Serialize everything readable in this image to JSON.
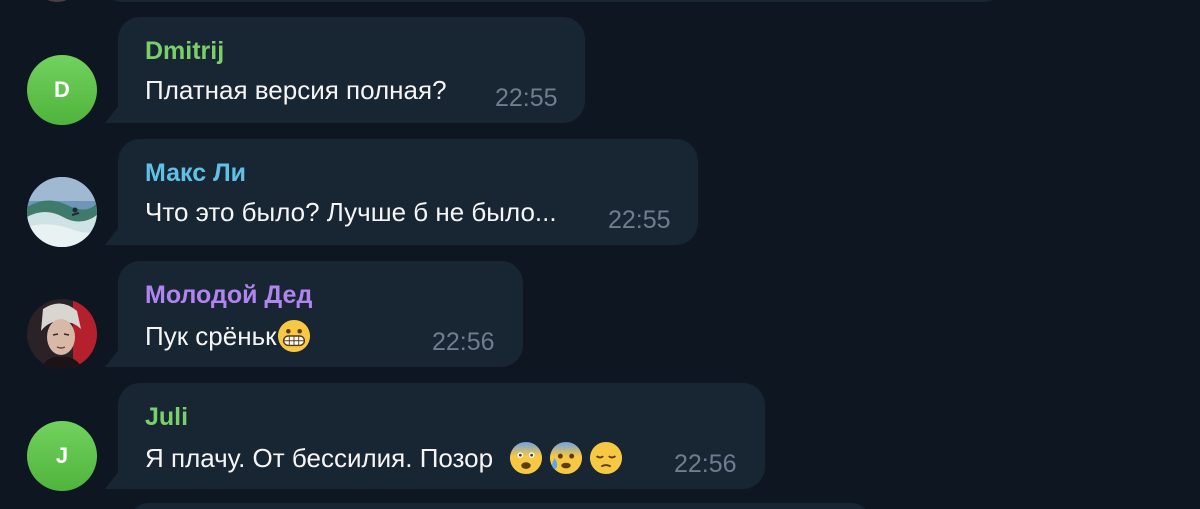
{
  "colors": {
    "background": "#0e1621",
    "bubble": "#182533",
    "time": "#6d7f8f",
    "text": "#f5f5f5"
  },
  "messages": [
    {
      "sender": "Dmitrij",
      "sender_color": "#7ccf68",
      "avatar_type": "letter",
      "avatar_letter": "D",
      "text": "Платная версия полная?",
      "time": "22:55"
    },
    {
      "sender": "Макс Ли",
      "sender_color": "#5fc1e6",
      "avatar_type": "photo-wave-surfer",
      "text": "Что это было? Лучше б не было...",
      "time": "22:55"
    },
    {
      "sender": "Молодой Дед",
      "sender_color": "#b185f0",
      "avatar_type": "photo-portrait",
      "text": "Пук срёньк",
      "emojis": [
        "grinning-face-emoji"
      ],
      "time": "22:56"
    },
    {
      "sender": "Juli",
      "sender_color": "#7ccf68",
      "avatar_type": "letter",
      "avatar_letter": "J",
      "text": "Я плачу. От бессилия. Позор",
      "emojis": [
        "fearful-face-emoji",
        "anxious-face-with-sweat-emoji",
        "pensive-face-emoji"
      ],
      "time": "22:56"
    }
  ]
}
